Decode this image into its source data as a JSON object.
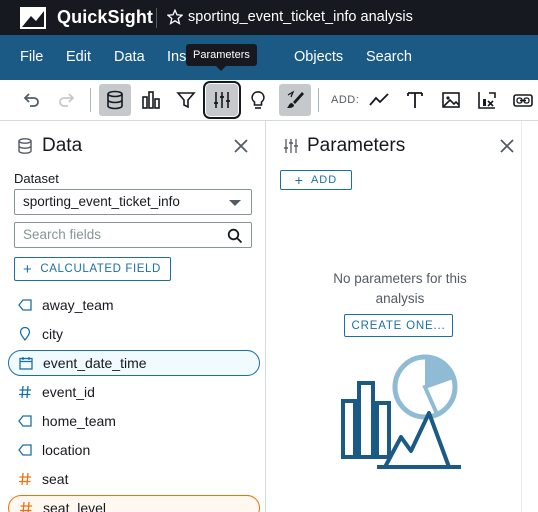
{
  "app": {
    "brand": "QuickSight",
    "analysis_title": "sporting_event_ticket_info analysis"
  },
  "menu": {
    "items": [
      "File",
      "Edit",
      "Data",
      "Insights",
      "Objects",
      "Search"
    ],
    "tooltip": "Parameters"
  },
  "toolbar": {
    "add_label": "ADD:"
  },
  "data_panel": {
    "title": "Data",
    "dataset_label": "Dataset",
    "dataset_value": "sporting_event_ticket_info",
    "search_placeholder": "Search fields",
    "calc_button": "CALCULATED FIELD",
    "fields": [
      {
        "name": "away_team",
        "icon": "dimension-tag-icon",
        "state": "none"
      },
      {
        "name": "city",
        "icon": "geo-pin-icon",
        "state": "none"
      },
      {
        "name": "event_date_time",
        "icon": "calendar-icon",
        "state": "blue"
      },
      {
        "name": "event_id",
        "icon": "hash-icon",
        "state": "none"
      },
      {
        "name": "home_team",
        "icon": "dimension-tag-icon",
        "state": "none"
      },
      {
        "name": "location",
        "icon": "dimension-tag-icon",
        "state": "none"
      },
      {
        "name": "seat",
        "icon": "hash-icon",
        "state": "none"
      },
      {
        "name": "seat_level",
        "icon": "hash-icon",
        "state": "orange"
      }
    ]
  },
  "params_panel": {
    "title": "Parameters",
    "add_button": "ADD",
    "empty_message": "No parameters for this analysis",
    "create_button": "CREATE ONE..."
  },
  "colors": {
    "topbar": "#16191f",
    "menubar": "#1b5a85",
    "accent": "#1b6fa8",
    "measure": "#ec7211"
  }
}
